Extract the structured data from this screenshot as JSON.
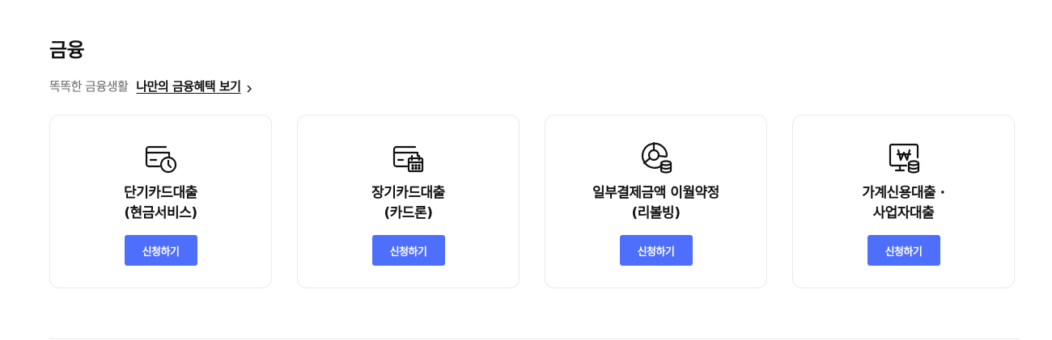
{
  "section": {
    "title": "금융",
    "subtitle": "똑똑한 금융생활",
    "link_label": "나만의 금융혜택 보기"
  },
  "cards": [
    {
      "icon": "card-clock-icon",
      "title_line1": "단기카드대출",
      "title_line2": "(현금서비스)",
      "button_label": "신청하기"
    },
    {
      "icon": "card-calendar-icon",
      "title_line1": "장기카드대출",
      "title_line2": "(카드론)",
      "button_label": "신청하기"
    },
    {
      "icon": "pie-chart-coins-icon",
      "title_line1": "일부결제금액 이월약정",
      "title_line2": "(리볼빙)",
      "button_label": "신청하기"
    },
    {
      "icon": "monitor-won-coins-icon",
      "title_line1": "가계신용대출 ·",
      "title_line2": "사업자대출",
      "button_label": "신청하기"
    }
  ],
  "colors": {
    "accent": "#4d6ffb",
    "text": "#111111",
    "muted": "#666666",
    "border": "#e9eaec"
  }
}
